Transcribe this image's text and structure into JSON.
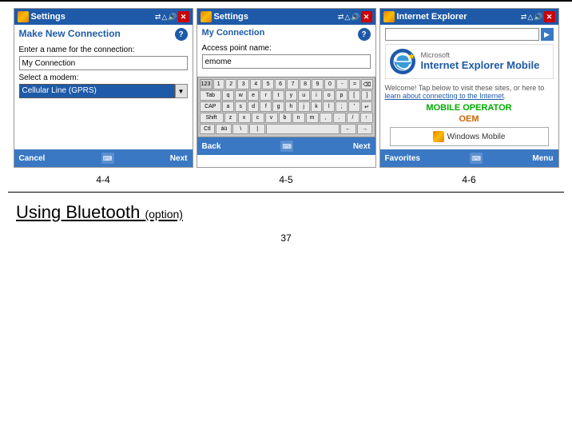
{
  "top_border": true,
  "screenshots": [
    {
      "id": "screen1",
      "titlebar": {
        "title": "Settings",
        "icons": [
          "signal",
          "battery",
          "volume",
          "close"
        ]
      },
      "heading": "Make New Connection",
      "help_icon": "?",
      "label1": "Enter a name for the connection:",
      "input_value": "My Connection",
      "label2": "Select a modem:",
      "select_value": "Cellular Line (GPRS)",
      "toolbar": {
        "left": "Cancel",
        "right": "Next"
      }
    },
    {
      "id": "screen2",
      "titlebar": {
        "title": "Settings",
        "icons": [
          "signal",
          "battery",
          "volume",
          "close"
        ]
      },
      "heading": "My Connection",
      "help_icon": "?",
      "label1": "Access point name:",
      "input_value": "emome",
      "keyboard": {
        "row0": [
          "123",
          "1",
          "2",
          "3",
          "4",
          "5",
          "6",
          "7",
          "8",
          "9",
          "0",
          "-",
          "=",
          "⌫"
        ],
        "row1": [
          "Tab",
          "q",
          "w",
          "e",
          "r",
          "t",
          "y",
          "u",
          "i",
          "o",
          "p",
          "[",
          "]"
        ],
        "row2": [
          "CAP",
          "a",
          "s",
          "d",
          "f",
          "g",
          "h",
          "j",
          "k",
          "l",
          ";",
          "'",
          "↵"
        ],
        "row3": [
          "Shift",
          "z",
          "x",
          "c",
          "v",
          "b",
          "n",
          "m",
          ",",
          ".",
          "/",
          "↑"
        ],
        "row4": [
          "Ctl",
          "áü",
          "\\",
          "|",
          " ",
          "←",
          "→"
        ]
      },
      "toolbar": {
        "left": "Back",
        "right": "Next"
      }
    },
    {
      "id": "screen3",
      "titlebar": {
        "title": "Internet Explorer",
        "icons": [
          "signal",
          "battery",
          "volume",
          "close"
        ]
      },
      "search_placeholder": "",
      "welcome_text": "Welcome! Tap below to visit these sites, or here to",
      "welcome_link": "learn about connecting to the Internet",
      "mobile_operator_label": "MOBILE OPERATOR",
      "oem_label": "OEM",
      "windows_mobile_label": "Windows Mobile",
      "toolbar": {
        "left": "Favorites",
        "right": "Menu"
      }
    }
  ],
  "captions": [
    "4-4",
    "4-5",
    "4-6"
  ],
  "bluetooth_heading": "Using Bluetooth",
  "bluetooth_option": "(option)",
  "page_number": "37"
}
